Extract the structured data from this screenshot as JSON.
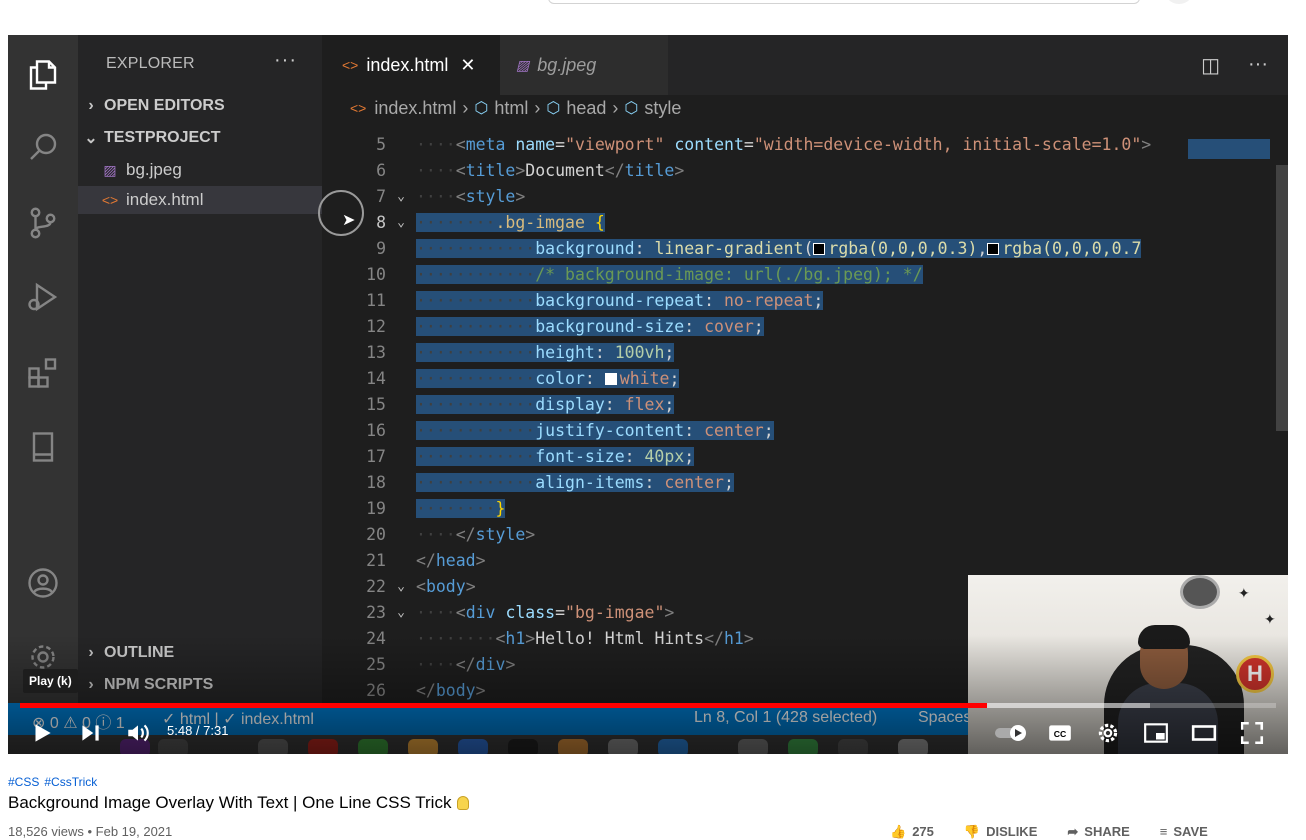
{
  "player": {
    "tooltip": "Play (k)",
    "time": "5:48 / 7:31",
    "progress_played": 0.77,
    "progress_loaded": 0.9
  },
  "vscode": {
    "explorer_title": "EXPLORER",
    "more": "···",
    "sections": {
      "open_editors": "OPEN EDITORS",
      "project": "TESTPROJECT",
      "outline": "OUTLINE",
      "npm_scripts": "NPM SCRIPTS"
    },
    "files": [
      {
        "name": "bg.jpeg",
        "icon": "image-icon"
      },
      {
        "name": "index.html",
        "icon": "html-file-icon"
      }
    ],
    "tabs": {
      "active": "index.html",
      "close": "✕",
      "inactive": "bg.jpeg"
    },
    "breadcrumb": [
      "index.html",
      "html",
      "head",
      "style"
    ],
    "status": {
      "problems": "⊗ 0  ⚠ 0  ⓘ 1",
      "validation": "✓ html | ✓ index.html",
      "cursor": "Ln 8, Col 1 (428 selected)",
      "spaces": "Spaces"
    }
  },
  "code": {
    "line_numbers": [
      "5",
      "6",
      "7",
      "8",
      "9",
      "10",
      "11",
      "12",
      "13",
      "14",
      "15",
      "16",
      "17",
      "18",
      "19",
      "20",
      "21",
      "22",
      "23",
      "24",
      "25",
      "26"
    ],
    "l5": {
      "attr1": "name",
      "val1": "\"viewport\"",
      "attr2": "content",
      "val2": "\"width=device-width, initial-scale=1.0\""
    },
    "l6": {
      "text": "Document"
    },
    "l7": {
      "tag": "style"
    },
    "l8": {
      "selector": ".bg-imgae",
      "brace": "{"
    },
    "l9": {
      "prop": "background",
      "fn": "linear-gradient",
      "a": "rgba(0,0,0,0.3)",
      "b": "rgba(0,0,0,0.7"
    },
    "l10": {
      "comment": "/* background-image: url(./bg.jpeg); */"
    },
    "l11": {
      "prop": "background-repeat",
      "val": "no-repeat"
    },
    "l12": {
      "prop": "background-size",
      "val": "cover"
    },
    "l13": {
      "prop": "height",
      "val": "100vh"
    },
    "l14": {
      "prop": "color",
      "val": "white"
    },
    "l15": {
      "prop": "display",
      "val": "flex"
    },
    "l16": {
      "prop": "justify-content",
      "val": "center"
    },
    "l17": {
      "prop": "font-size",
      "val": "40px"
    },
    "l18": {
      "prop": "align-items",
      "val": "center"
    },
    "l19": {
      "brace": "}"
    },
    "l20": {
      "tag": "style"
    },
    "l21": {
      "tag": "head"
    },
    "l22": {
      "tag": "body"
    },
    "l23": {
      "tag": "div",
      "attr": "class",
      "val": "\"bg-imgae\""
    },
    "l24": {
      "tag": "h1",
      "text": "Hello! Html Hints"
    },
    "l25": {
      "tag": "div"
    },
    "l26": {
      "tag": "body"
    }
  },
  "video": {
    "hashtags": [
      "#CSS",
      "#CssTrick"
    ],
    "title": "Background Image Overlay With Text | One Line CSS Trick",
    "meta": "18,526 views • Feb 19, 2021",
    "actions": [
      "275",
      "DISLIKE",
      "SHARE",
      "SAVE"
    ]
  },
  "colors": {
    "accent_red": "#ff0000",
    "vscode_blue": "#007acc",
    "selection": "#264f78",
    "link": "#065fd4"
  }
}
